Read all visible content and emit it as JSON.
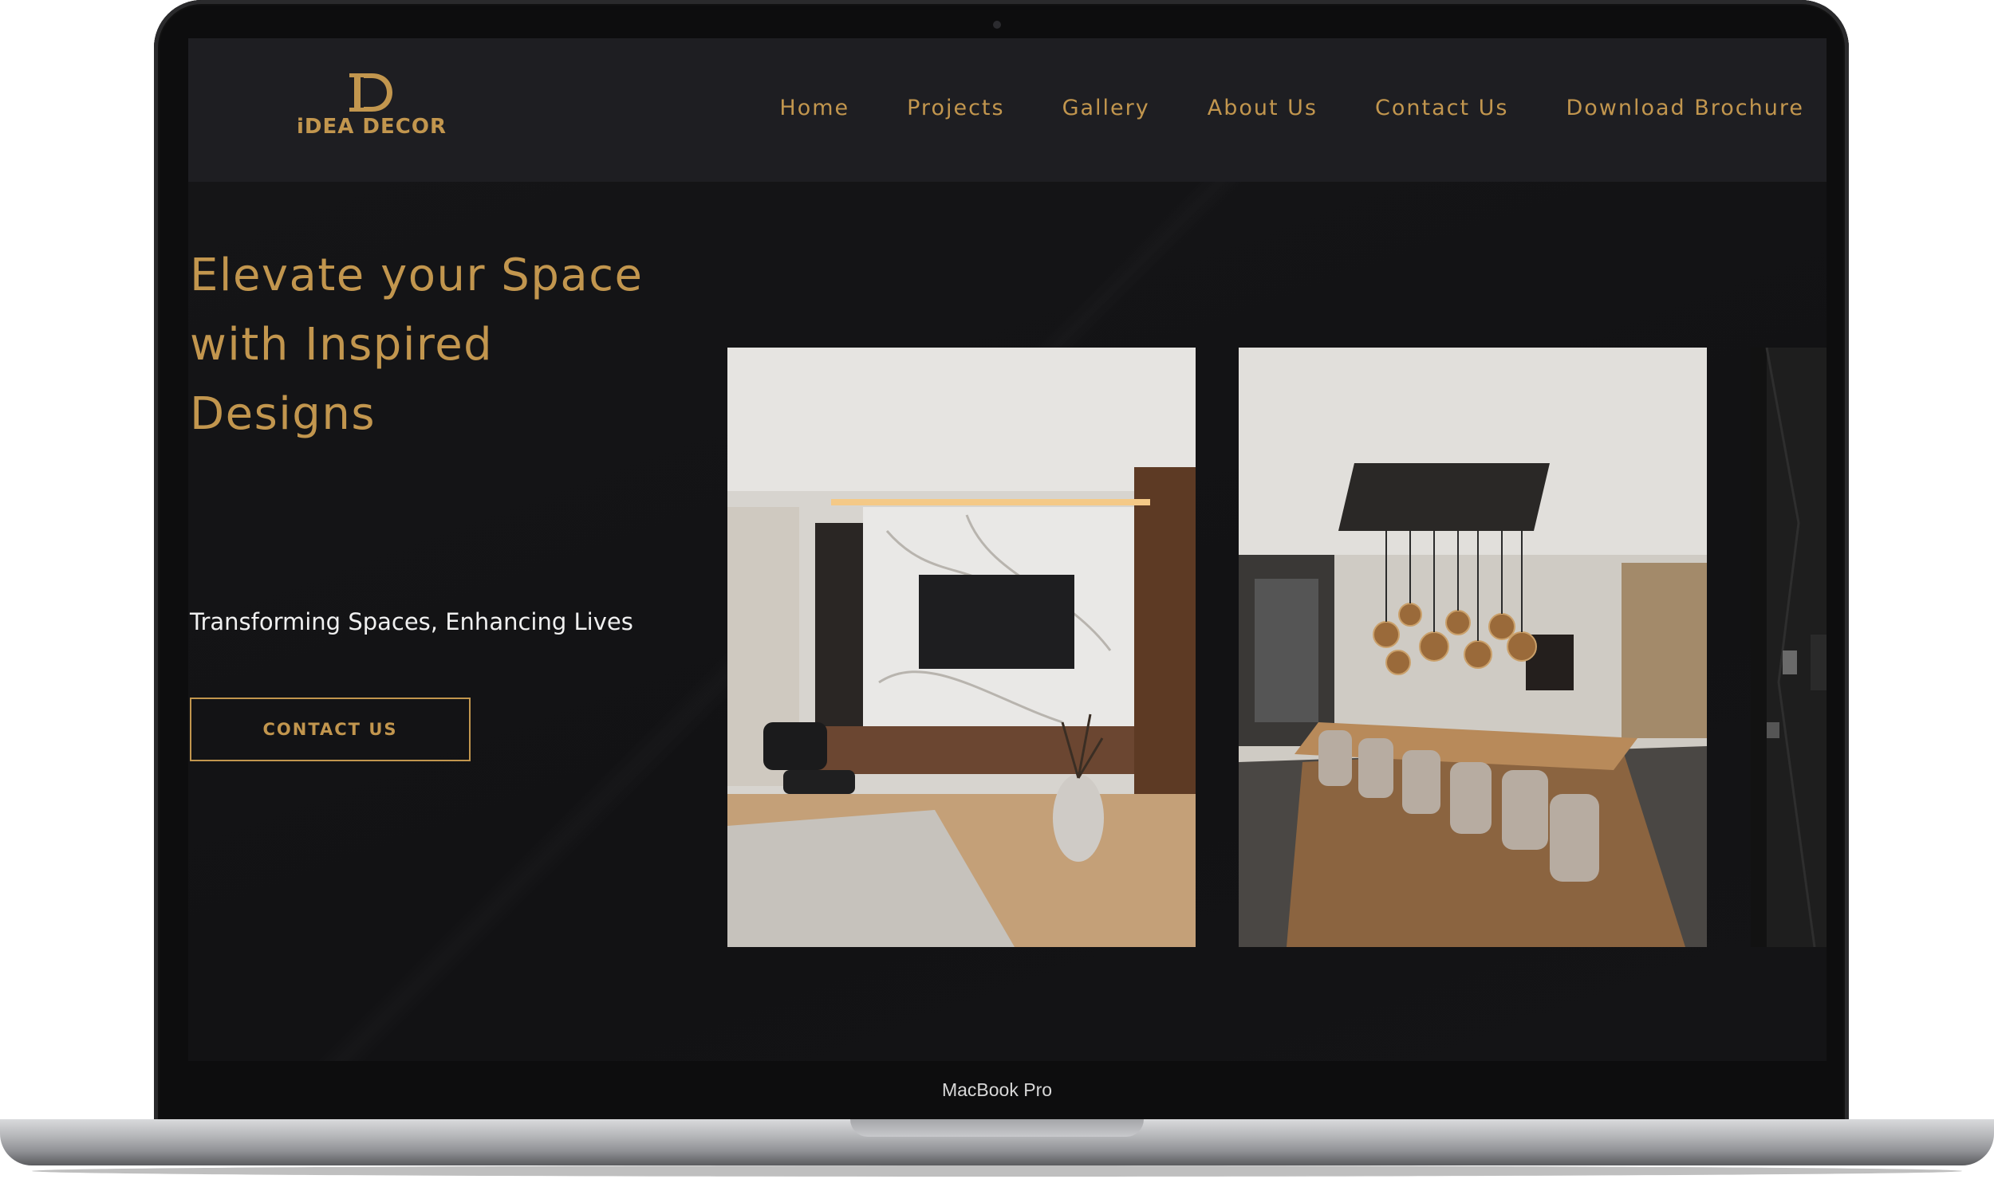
{
  "device": {
    "label": "MacBook Pro"
  },
  "brand": {
    "logo_text": "iDEA DECOR",
    "accent_color": "#c2964e",
    "background_color": "#141416",
    "navbar_color": "#1e1e22"
  },
  "nav": {
    "items": [
      {
        "label": "Home"
      },
      {
        "label": "Projects"
      },
      {
        "label": "Gallery"
      },
      {
        "label": "About Us"
      },
      {
        "label": "Contact Us"
      },
      {
        "label": "Download Brochure"
      }
    ]
  },
  "hero": {
    "title_lines": [
      "Elevate your Space",
      "with Inspired",
      "Designs"
    ],
    "subtitle": "Transforming Spaces, Enhancing Lives",
    "cta_label": "CONTACT US"
  },
  "gallery": {
    "images": [
      {
        "subject": "living-room-photo"
      },
      {
        "subject": "dining-room-photo"
      },
      {
        "subject": "dark-wall-photo"
      }
    ]
  }
}
